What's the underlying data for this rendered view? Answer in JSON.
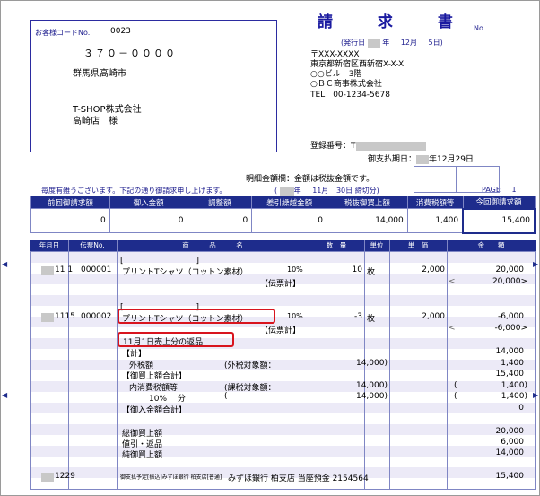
{
  "title": "請 求 書",
  "no_label": "No.",
  "issue_date": {
    "prefix": "(発行日",
    "year_suffix": "年",
    "month": "12月",
    "day": "5日)"
  },
  "customer": {
    "code_label": "お客様コードNo.",
    "code": "0023",
    "postal": "３７０－００００",
    "address": "群馬県高崎市",
    "company": "T-SHOP株式会社",
    "branch": "高崎店　様"
  },
  "issuer": {
    "postal": "〒XXX-XXXX",
    "address": "東京都新宿区西新宿X-X-X",
    "building": "○○ビル　3階",
    "company": "○ＢＣ商事株式会社",
    "tel": "TEL　00-1234-5678",
    "reg_label": "登録番号：T",
    "due_label": "御支払期日：",
    "due_date": "年12月29日"
  },
  "tax_note": "明細金額欄：金額は税抜金額です。",
  "greeting": "毎度有難うございます。下記の通り御請求申し上げます。",
  "closing": {
    "open": "(",
    "year": "年",
    "month": "11月",
    "day": "30日",
    "close": "締切分)"
  },
  "page": {
    "label": "PAGE",
    "number": "1"
  },
  "summary": {
    "headers": [
      "前回御請求額",
      "御入金額",
      "調整額",
      "差引繰越金額",
      "税抜御買上額",
      "消費税額等",
      "今回御請求額"
    ],
    "values": [
      "0",
      "0",
      "0",
      "0",
      "14,000",
      "1,400",
      "15,400"
    ]
  },
  "table_headers": [
    "年月日",
    "伝票No.",
    "商　　　品　　　名",
    "数　量",
    "単位",
    "単　価",
    "金　　額"
  ],
  "rows": {
    "r1_bracket": "[　　　　　　　　　]",
    "r1_date": "11 1",
    "r1_slip": "000001",
    "r1_product": "プリントTシャツ（コットン素材）",
    "r1_tax": "10%",
    "r1_qty": "10",
    "r1_unit": "枚",
    "r1_price": "2,000",
    "r1_amount": "20,000",
    "r1_subtotal_label": "【伝票計】",
    "r1_subtotal_lt": "<",
    "r1_subtotal": "20,000>",
    "r2_bracket": "[　　　　　　　　　]",
    "r2_date": "1115",
    "r2_slip": "000002",
    "r2_product": "プリントTシャツ（コットン素材）",
    "r2_tax": "10%",
    "r2_qty": "-3",
    "r2_unit": "枚",
    "r2_price": "2,000",
    "r2_amount": "-6,000",
    "r2_subtotal_label": "【伝票計】",
    "r2_subtotal_lt": "<",
    "r2_subtotal": "-6,000>",
    "r2_note": "11月1日売上分の返品",
    "total_label": "【計】",
    "total_amount": "14,000",
    "outside_label": "外税額",
    "outside_basis_label": "(外税対象額：",
    "outside_basis": "14,000)",
    "outside_amount": "1,400",
    "purchase_total_label": "【御買上額合計】",
    "purchase_total": "15,400",
    "internal_label": "内消費税額等",
    "internal_basis_label": "(課税対象額：",
    "internal_basis": "14,000)",
    "internal_open": "(",
    "internal_amount": "1,400)",
    "rate_label": "10%　 分",
    "rate_open": "(",
    "rate_basis": "14,000)",
    "rate_paren": "(",
    "rate_amount": "1,400)",
    "deposit_total_label": "【御入金額合計】",
    "deposit_total": "0",
    "gross_label": "総御買上額",
    "gross": "20,000",
    "returns_label": "値引・返品",
    "returns": "6,000",
    "net_label": "純御買上額",
    "net": "14,000",
    "last_date": "1229",
    "last_small": "御支払予定[振込]みずほ銀行 柏支店[普通]",
    "last_bank": "みずほ銀行 柏支店 当座預金 2154564",
    "last_amount": "15,400"
  },
  "colors": {
    "navy": "#1e2c8c",
    "highlight": "#d8141e",
    "stripe": "#eceaf7"
  }
}
